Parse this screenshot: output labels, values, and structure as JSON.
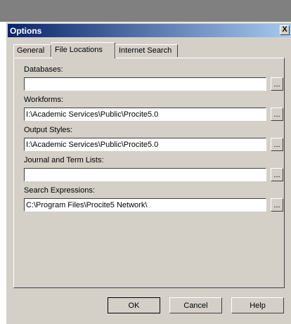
{
  "window": {
    "title": "Options",
    "close_label": "X"
  },
  "tabs": [
    {
      "label": "General",
      "active": false
    },
    {
      "label": "File Locations",
      "active": true
    },
    {
      "label": "Internet Search",
      "active": false
    }
  ],
  "fields": [
    {
      "label": "Databases:",
      "value": "",
      "browse_label": "..."
    },
    {
      "label": "Workforms:",
      "value": "I:\\Academic Services\\Public\\Procite5.0",
      "browse_label": "..."
    },
    {
      "label": "Output Styles:",
      "value": "I:\\Academic Services\\Public\\Procite5.0",
      "browse_label": "..."
    },
    {
      "label": "Journal and Term Lists:",
      "value": "",
      "browse_label": "..."
    },
    {
      "label": "Search Expressions:",
      "value": "C:\\Program Files\\Procite5 Network\\",
      "browse_label": "..."
    }
  ],
  "buttons": {
    "ok": "OK",
    "cancel": "Cancel",
    "help": "Help"
  },
  "colors": {
    "dialog_face": "#d4d0c8",
    "title_active": "#0a246a",
    "title_gradient_end": "#a6caf0",
    "backdrop": "#808080"
  }
}
